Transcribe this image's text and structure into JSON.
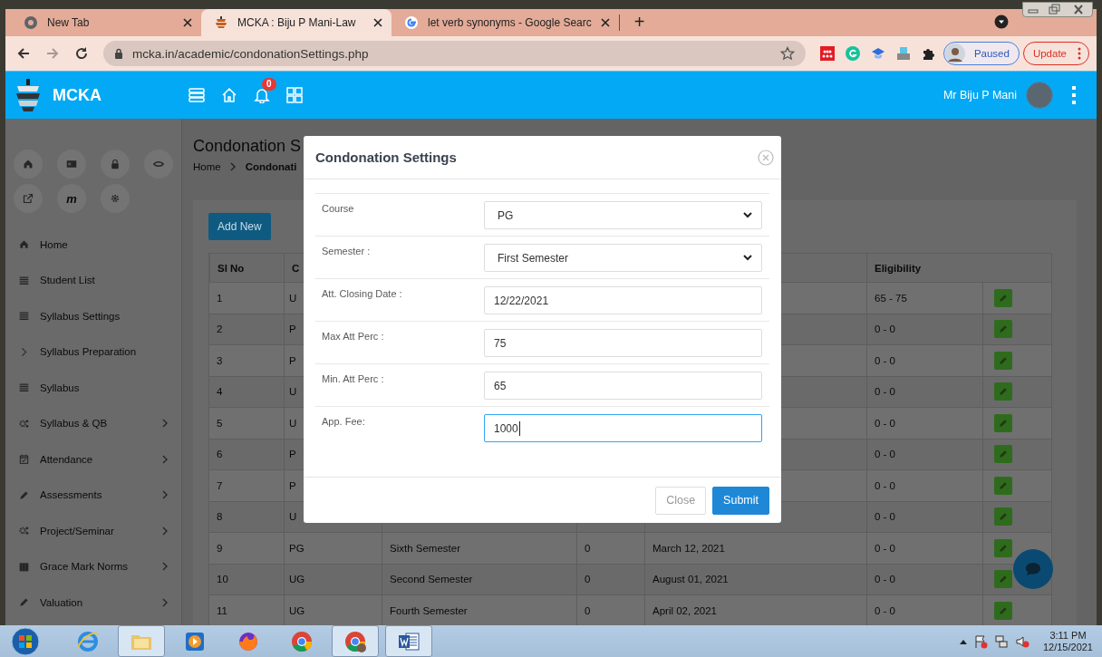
{
  "browser": {
    "tabs": [
      {
        "title": "New Tab",
        "selected": false
      },
      {
        "title": "MCKA : Biju P Mani-Law",
        "selected": true
      },
      {
        "title": "let verb synonyms - Google Searc",
        "selected": false
      }
    ],
    "new_tab_button": "+",
    "forward_disabled": true,
    "address": "mcka.in/academic/condonationSettings.php",
    "profile_chip": "Paused",
    "update_button": "Update"
  },
  "app_header": {
    "brand": "MCKA",
    "notification_count": "0",
    "user_name": "Mr Biju P Mani"
  },
  "sidebar": {
    "quick_letter": "m",
    "menu": [
      {
        "label": "Home",
        "has_submenu": false
      },
      {
        "label": "Student List",
        "has_submenu": false
      },
      {
        "label": "Syllabus Settings",
        "has_submenu": false
      },
      {
        "label": "Syllabus Preparation",
        "has_submenu": false
      },
      {
        "label": "Syllabus",
        "has_submenu": false
      },
      {
        "label": "Syllabus & QB",
        "has_submenu": true
      },
      {
        "label": "Attendance",
        "has_submenu": true
      },
      {
        "label": "Assessments",
        "has_submenu": true
      },
      {
        "label": "Project/Seminar",
        "has_submenu": true
      },
      {
        "label": "Grace Mark Norms",
        "has_submenu": true
      },
      {
        "label": "Valuation",
        "has_submenu": true
      }
    ]
  },
  "page": {
    "title": "Condonation S",
    "breadcrumb": [
      "Home",
      "Condonati"
    ],
    "add_button": "Add New",
    "table": {
      "columns": [
        "Sl No",
        "C",
        "Eligibility"
      ],
      "rows": [
        {
          "sl_no": "1",
          "course": "U",
          "eligibility": "65 - 75"
        },
        {
          "sl_no": "2",
          "course": "P",
          "eligibility": "0 - 0"
        },
        {
          "sl_no": "3",
          "course": "P",
          "eligibility": "0 - 0"
        },
        {
          "sl_no": "4",
          "course": "U",
          "eligibility": "0 - 0"
        },
        {
          "sl_no": "5",
          "course": "U",
          "eligibility": "0 - 0"
        },
        {
          "sl_no": "6",
          "course": "P",
          "eligibility": "0 - 0"
        },
        {
          "sl_no": "7",
          "course": "P",
          "eligibility": "0 - 0"
        },
        {
          "sl_no": "8",
          "course": "U",
          "eligibility": "0 - 0"
        },
        {
          "sl_no": "9",
          "course": "PG",
          "semester": "Sixth Semester",
          "column_4": "0",
          "date": "March 12, 2021",
          "eligibility": "0 - 0"
        },
        {
          "sl_no": "10",
          "course": "UG",
          "semester": "Second Semester",
          "column_4": "0",
          "date": "August 01, 2021",
          "eligibility": "0 - 0"
        },
        {
          "sl_no": "11",
          "course": "UG",
          "semester": "Fourth Semester",
          "column_4": "0",
          "date": "April 02, 2021",
          "eligibility": "0 - 0"
        }
      ]
    }
  },
  "modal": {
    "title": "Condonation Settings",
    "fields": [
      {
        "label": "Course",
        "kind": "select",
        "value": "PG",
        "focused": false
      },
      {
        "label": "Semester :",
        "kind": "select",
        "value": "First Semester",
        "focused": false
      },
      {
        "label": "Att. Closing Date :",
        "kind": "text",
        "value": "12/22/2021",
        "focused": false
      },
      {
        "label": "Max Att Perc :",
        "kind": "text",
        "value": "75",
        "focused": false
      },
      {
        "label": "Min. Att Perc :",
        "kind": "text",
        "value": "65",
        "focused": false
      },
      {
        "label": "App. Fee:",
        "kind": "text",
        "value": "1000",
        "focused": true
      }
    ],
    "buttons": [
      {
        "label": "Close",
        "kind": "secondary"
      },
      {
        "label": "Submit",
        "kind": "primary"
      }
    ]
  },
  "taskbar": {
    "apps": [
      {
        "active": false
      },
      {
        "active": true
      },
      {
        "active": false
      },
      {
        "active": false
      },
      {
        "active": false
      },
      {
        "active": true
      },
      {
        "active": true
      }
    ],
    "time": "3:11 PM",
    "date": "12/15/2021"
  }
}
